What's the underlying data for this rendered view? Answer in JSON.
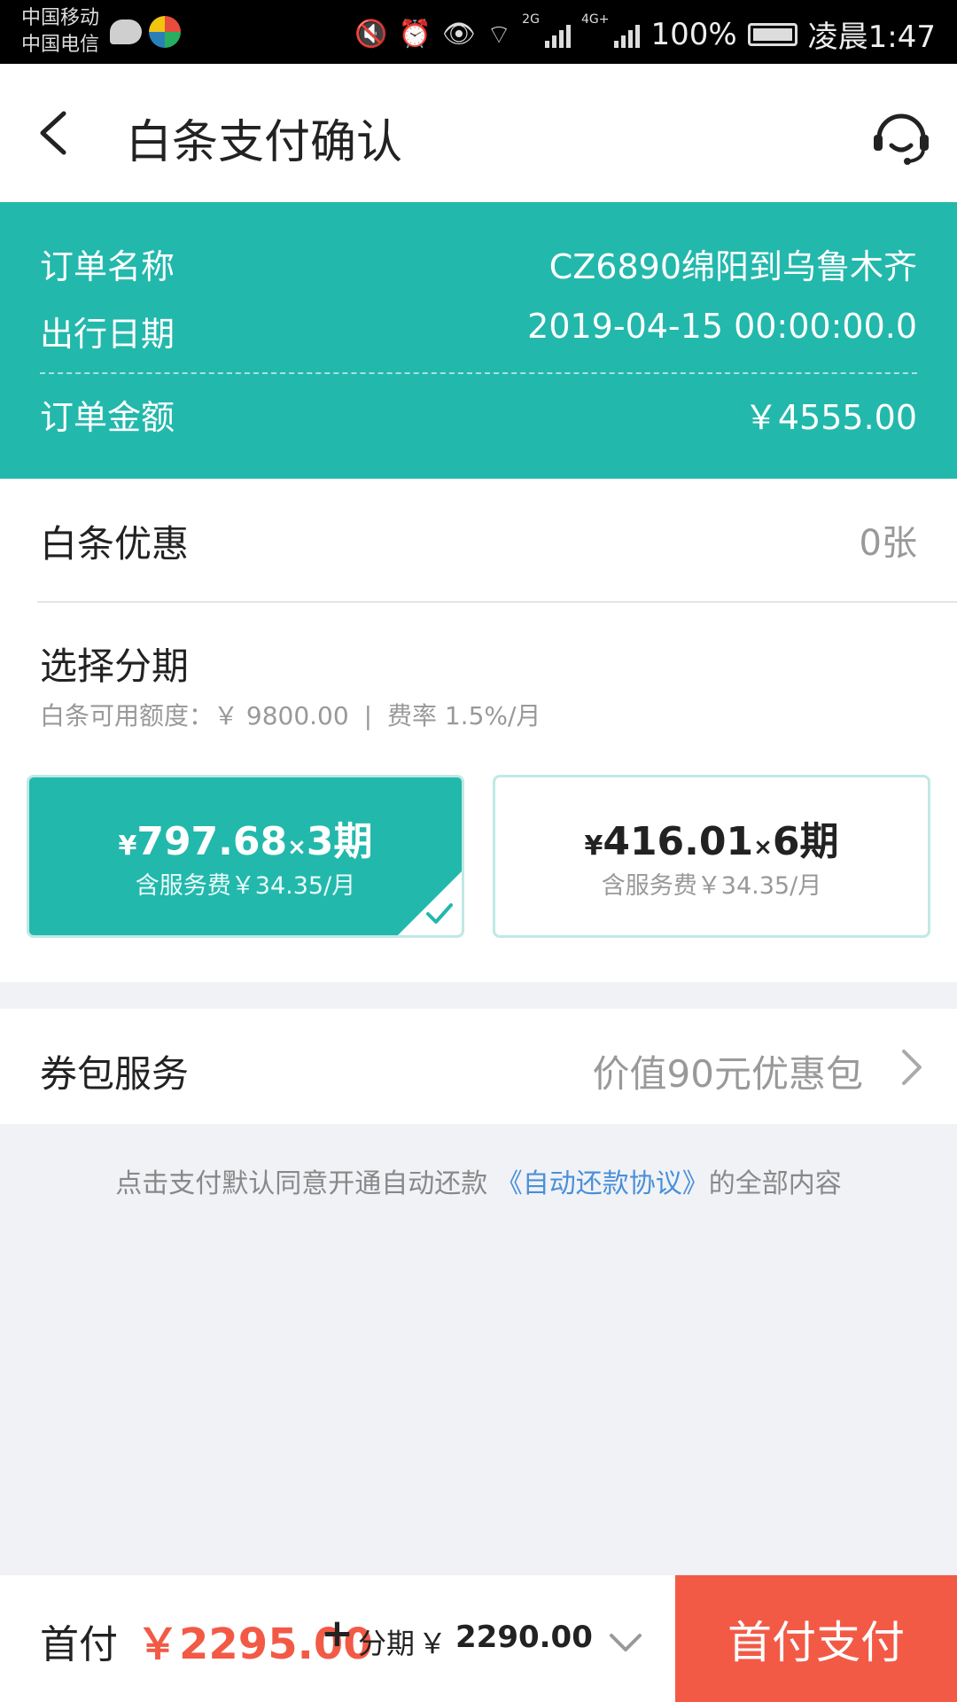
{
  "status_bar": {
    "carrier1": "中国移动",
    "carrier2": "中国电信",
    "battery": "100%",
    "time": "凌晨1:47",
    "net1": "2G",
    "net2": "4G+"
  },
  "header": {
    "title": "白条支付确认",
    "back_icon": "chevron-left-icon",
    "service_icon": "headset-icon"
  },
  "order": {
    "name_label": "订单名称",
    "name_value": "CZ6890绵阳到乌鲁木齐",
    "date_label": "出行日期",
    "date_value": "2019-04-15 00:00:00.0",
    "amount_label": "订单金额",
    "amount_value": "￥4555.00"
  },
  "coupon": {
    "label": "白条优惠",
    "value": "0张"
  },
  "installment": {
    "title": "选择分期",
    "credit": "白条可用额度：￥ 9800.00",
    "separator": "|",
    "rate": "费率 1.5%/月",
    "plans": [
      {
        "currency": "¥",
        "amount": "797.68",
        "times": "×",
        "periods": "3期",
        "fee": "含服务费￥34.35/月",
        "selected": true
      },
      {
        "currency": "¥",
        "amount": "416.01",
        "times": "×",
        "periods": "6期",
        "fee": "含服务费￥34.35/月",
        "selected": false
      }
    ]
  },
  "package": {
    "label": "券包服务",
    "value": "价值90元优惠包"
  },
  "agreement": {
    "prefix": "点击支付默认同意开通自动还款",
    "link": "《自动还款协议》",
    "suffix": "的全部内容"
  },
  "bottom": {
    "down_label": "首付",
    "down_amount": "￥2295.00",
    "plus": "+",
    "inst_label": "分期",
    "inst_currency": "￥",
    "inst_amount": "2290.00",
    "pay_button": "首付支付"
  },
  "colors": {
    "teal": "#23b8ac",
    "red": "#f25a46",
    "link": "#4a90d9"
  }
}
